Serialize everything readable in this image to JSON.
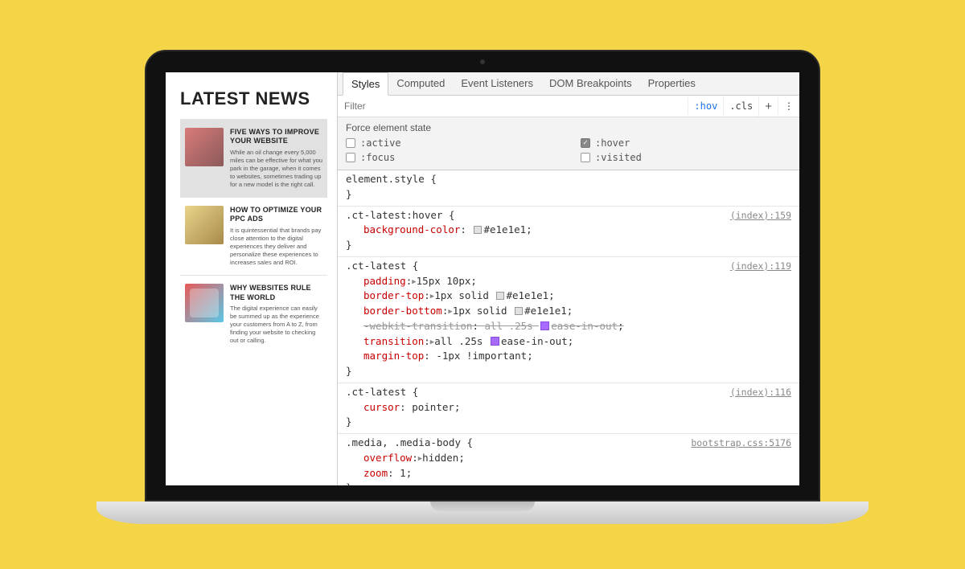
{
  "left": {
    "heading": "LATEST NEWS",
    "items": [
      {
        "title": "FIVE WAYS TO IMPROVE YOUR WEBSITE",
        "body": "While an oil change every 5,000 miles can be effective for what you park in the garage, when it comes to websites, sometimes trading up for a new model is the right call."
      },
      {
        "title": "HOW TO OPTIMIZE YOUR PPC ADS",
        "body": "It is quintessential that brands pay close attention to the digital experiences they deliver and personalize these experiences to increases sales and ROI."
      },
      {
        "title": "WHY WEBSITES RULE THE WORLD",
        "body": "The digital experience can easily be summed up as the experience your customers from A to Z, from finding your website to checking out or calling."
      }
    ]
  },
  "devtools": {
    "tabs": [
      "Styles",
      "Computed",
      "Event Listeners",
      "DOM Breakpoints",
      "Properties"
    ],
    "active_tab": "Styles",
    "filter_placeholder": "Filter",
    "hov_label": ":hov",
    "cls_label": ".cls",
    "force_state_title": "Force element state",
    "states": [
      {
        "label": ":active",
        "checked": false
      },
      {
        "label": ":hover",
        "checked": true
      },
      {
        "label": ":focus",
        "checked": false
      },
      {
        "label": ":visited",
        "checked": false
      }
    ],
    "rules": [
      {
        "selector": "element.style",
        "source": "",
        "dimmed": true,
        "decls": []
      },
      {
        "selector": ".ct-latest:hover",
        "source": "(index):159",
        "decls": [
          {
            "prop": "background-color",
            "swatch": "grey",
            "val": "#e1e1e1"
          }
        ]
      },
      {
        "selector": ".ct-latest",
        "source": "(index):119",
        "decls": [
          {
            "prop": "padding",
            "tri": true,
            "val": "15px 10px"
          },
          {
            "prop": "border-top",
            "tri": true,
            "val_pre": "1px solid ",
            "swatch": "grey",
            "val": "#e1e1e1"
          },
          {
            "prop": "border-bottom",
            "tri": true,
            "val_pre": "1px solid ",
            "swatch": "grey",
            "val": "#e1e1e1"
          },
          {
            "prop": "-webkit-transition",
            "val_pre": "all .25s ",
            "swatch": "bezier",
            "val": "ease-in-out",
            "struck": true
          },
          {
            "prop": "transition",
            "tri": true,
            "val_pre": "all .25s ",
            "swatch": "bezier",
            "val": "ease-in-out"
          },
          {
            "prop": "margin-top",
            "val": "-1px !important"
          }
        ]
      },
      {
        "selector": ".ct-latest",
        "source": "(index):116",
        "decls": [
          {
            "prop": "cursor",
            "val": "pointer"
          }
        ]
      },
      {
        "selector": ".media, .media-body",
        "source": "bootstrap.css:5176",
        "decls": [
          {
            "prop": "overflow",
            "tri": true,
            "val": "hidden"
          },
          {
            "prop": "zoom",
            "val": "1"
          }
        ]
      }
    ]
  }
}
